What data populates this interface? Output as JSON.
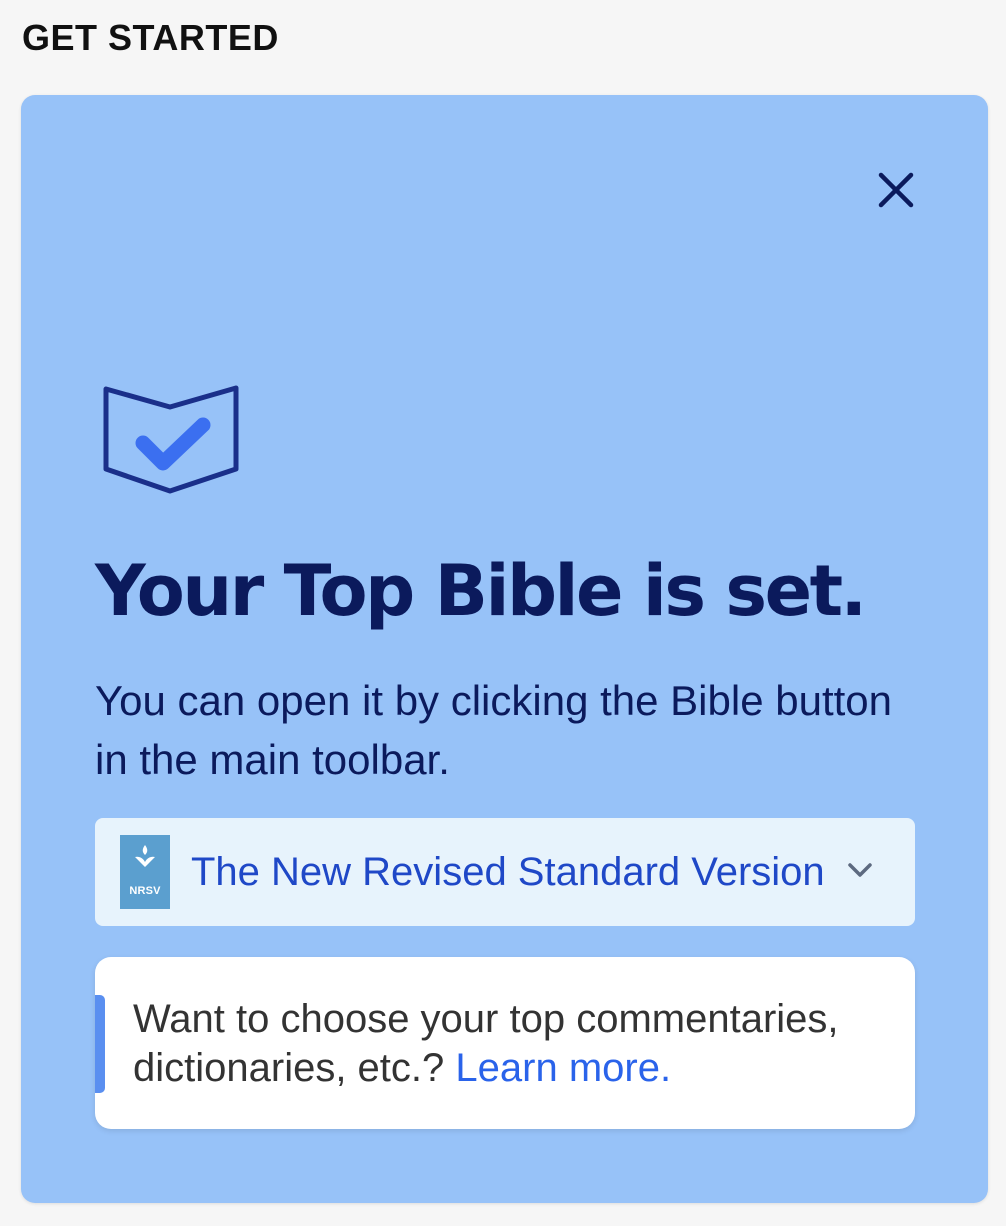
{
  "section": {
    "title": "GET STARTED"
  },
  "card": {
    "headline": "Your Top Bible is set.",
    "description": "You can open it by clicking the Bible button in the main toolbar.",
    "bible_selector": {
      "cover_label": "NRSV",
      "selected_bible": "The New Revised Standard Version"
    },
    "info": {
      "text": "Want to choose your top commentaries, dictionaries, etc.?",
      "link_label": "Learn more."
    }
  },
  "colors": {
    "card_background": "#97c2f8",
    "headline_text": "#0b1a5c",
    "link": "#2a63ea",
    "selector_background": "#e7f3fc",
    "accent": "#5a8ff0"
  },
  "icons": {
    "close": "close-icon",
    "book_check": "book-check-icon",
    "chevron": "chevron-down-icon",
    "cover_logo": "nrsv-logo-icon"
  }
}
